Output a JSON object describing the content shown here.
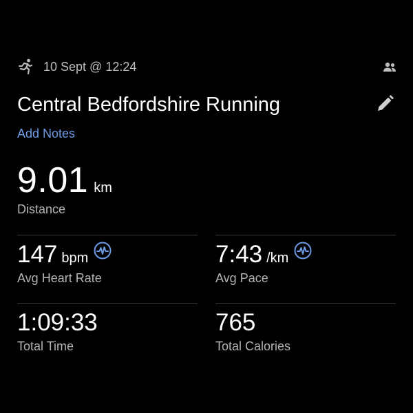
{
  "activity": {
    "date_time": "10 Sept @ 12:24",
    "title": "Central Bedfordshire Running",
    "add_notes_label": "Add Notes",
    "icons": {
      "activity_type": "running-icon",
      "privacy": "people-icon",
      "edit": "pencil-icon",
      "heart_rate_zone": "heart-rate-badge-icon"
    }
  },
  "distance": {
    "value": "9.01",
    "unit": "km",
    "label": "Distance"
  },
  "stats": {
    "heart_rate": {
      "value": "147",
      "unit": "bpm",
      "label": "Avg Heart Rate"
    },
    "pace": {
      "value": "7:43",
      "unit": "/km",
      "label": "Avg Pace"
    },
    "time": {
      "value": "1:09:33",
      "label": "Total Time"
    },
    "calories": {
      "value": "765",
      "label": "Total Calories"
    }
  },
  "colors": {
    "background": "#000000",
    "accent": "#6e9be6",
    "text_primary": "#ffffff",
    "text_secondary": "#b3b3b3",
    "divider": "#3a3a3a"
  }
}
